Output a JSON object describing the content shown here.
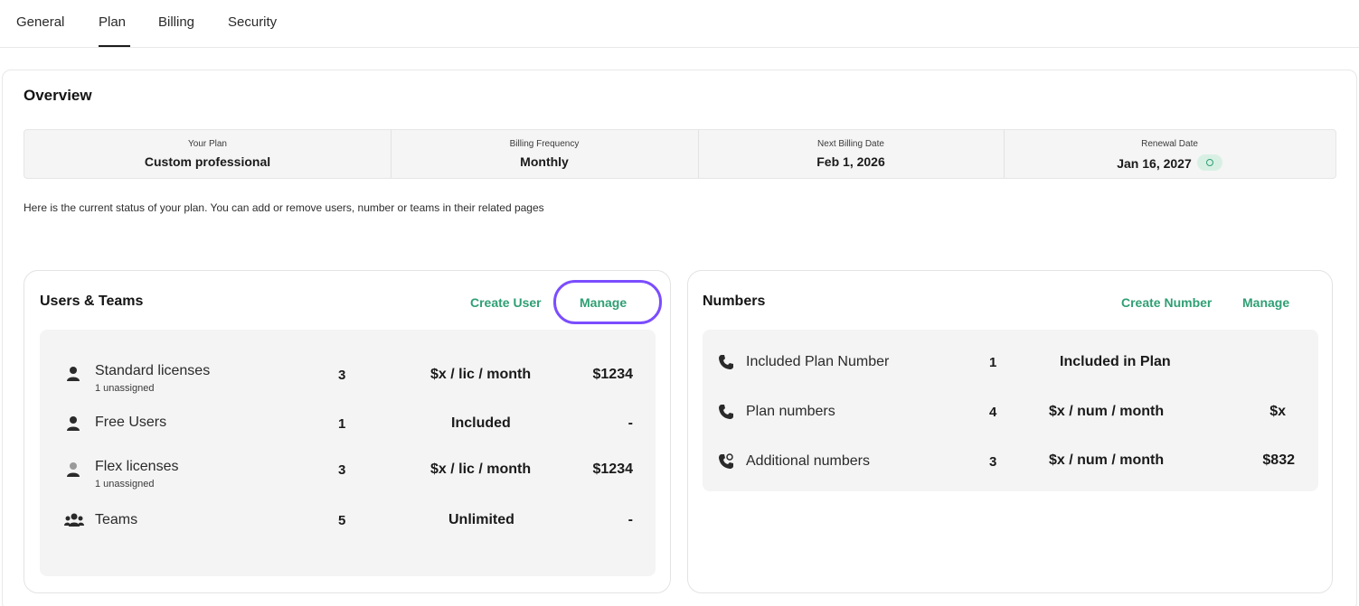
{
  "tabs": [
    {
      "label": "General"
    },
    {
      "label": "Plan"
    },
    {
      "label": "Billing"
    },
    {
      "label": "Security"
    }
  ],
  "active_tab": "Plan",
  "overview": {
    "title": "Overview",
    "summary": [
      {
        "label": "Your Plan",
        "value": "Custom professional"
      },
      {
        "label": "Billing Frequency",
        "value": "Monthly"
      },
      {
        "label": "Next Billing Date",
        "value": "Feb 1, 2026"
      },
      {
        "label": "Renewal Date",
        "value": "Jan 16, 2027"
      }
    ],
    "status_text": "Here is the current status of your plan. You can add or remove users, number or teams in their related pages"
  },
  "users_teams": {
    "title": "Users & Teams",
    "create_label": "Create User",
    "manage_label": "Manage",
    "rows": [
      {
        "icon": "user-icon",
        "name": "Standard licenses",
        "sub": "1 unassigned",
        "qty": "3",
        "price": "$x / lic / month",
        "total": "$1234"
      },
      {
        "icon": "user-icon",
        "name": "Free Users",
        "sub": "",
        "qty": "1",
        "price": "Included",
        "total": "-"
      },
      {
        "icon": "user-half-icon",
        "name": "Flex licenses",
        "sub": "1 unassigned",
        "qty": "3",
        "price": "$x / lic / month",
        "total": "$1234"
      },
      {
        "icon": "team-icon",
        "name": "Teams",
        "sub": "",
        "qty": "5",
        "price": "Unlimited",
        "total": "-"
      }
    ]
  },
  "numbers": {
    "title": "Numbers",
    "create_label": "Create Number",
    "manage_label": "Manage",
    "rows": [
      {
        "icon": "phone-icon",
        "name": "Included Plan Number",
        "qty": "1",
        "price": "Included in Plan",
        "total": ""
      },
      {
        "icon": "phone-icon",
        "name": "Plan numbers",
        "qty": "4",
        "price": "$x / num / month",
        "total": "$x"
      },
      {
        "icon": "phone-plus-icon",
        "name": "Additional numbers",
        "qty": "3",
        "price": "$x / num / month",
        "total": "$832"
      }
    ]
  },
  "colors": {
    "accent": "#2f9f74",
    "highlight": "#7b4dff",
    "panel_bg": "#f4f4f4"
  }
}
